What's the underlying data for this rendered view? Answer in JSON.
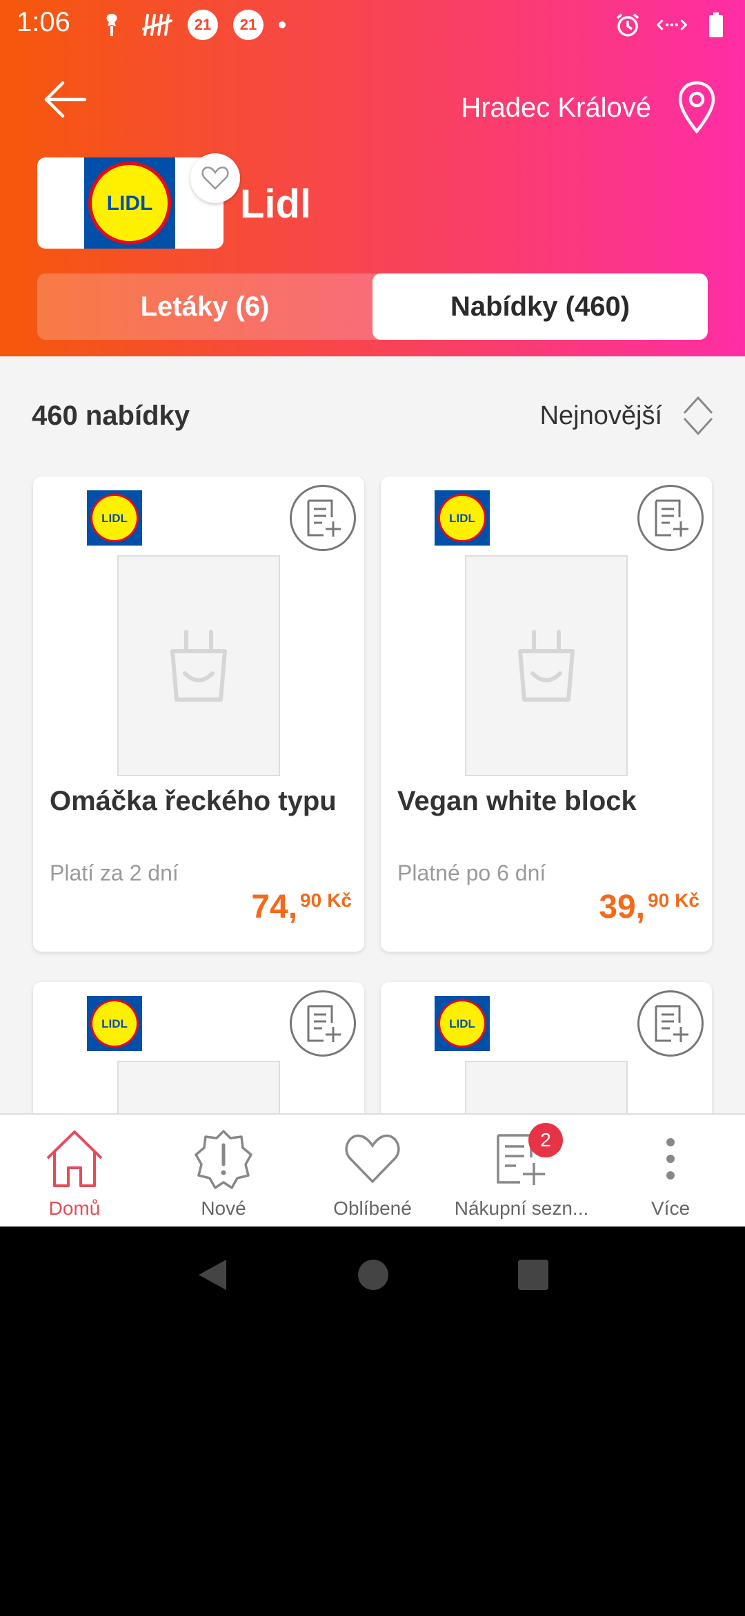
{
  "status_bar": {
    "time": "1:06",
    "badge_1": "21",
    "badge_2": "21"
  },
  "header": {
    "location": "Hradec Králové",
    "store_name": "Lidl",
    "logo_text": "LIDL"
  },
  "tabs": [
    {
      "label": "Letáky (6)",
      "active": false
    },
    {
      "label": "Nabídky (460)",
      "active": true
    }
  ],
  "list": {
    "count_label": "460 nabídky",
    "sort_label": "Nejnovější"
  },
  "offers": [
    {
      "title": "Omáčka řeckého typu",
      "validity": "Platí za 2 dní",
      "price_main": "74,",
      "price_dec": "90",
      "currency": "Kč"
    },
    {
      "title": "Vegan white block",
      "validity": "Platné po 6 dní",
      "price_main": "39,",
      "price_dec": "90",
      "currency": "Kč"
    },
    {
      "title": "",
      "validity": "",
      "price_main": "",
      "price_dec": "",
      "currency": ""
    },
    {
      "title": "",
      "validity": "",
      "price_main": "",
      "price_dec": "",
      "currency": ""
    }
  ],
  "bottom_nav": [
    {
      "label": "Domů",
      "icon": "home-icon",
      "active": true
    },
    {
      "label": "Nové",
      "icon": "alert-icon",
      "active": false
    },
    {
      "label": "Oblíbené",
      "icon": "heart-icon",
      "active": false
    },
    {
      "label": "Nákupní sezn...",
      "icon": "shopping-list-icon",
      "active": false,
      "badge": "2"
    },
    {
      "label": "Více",
      "icon": "more-icon",
      "active": false
    }
  ],
  "colors": {
    "gradient_start": "#f5580a",
    "gradient_end": "#ff2da6",
    "price": "#f26a1b",
    "active_nav": "#e54b5a",
    "badge": "#e63345"
  }
}
